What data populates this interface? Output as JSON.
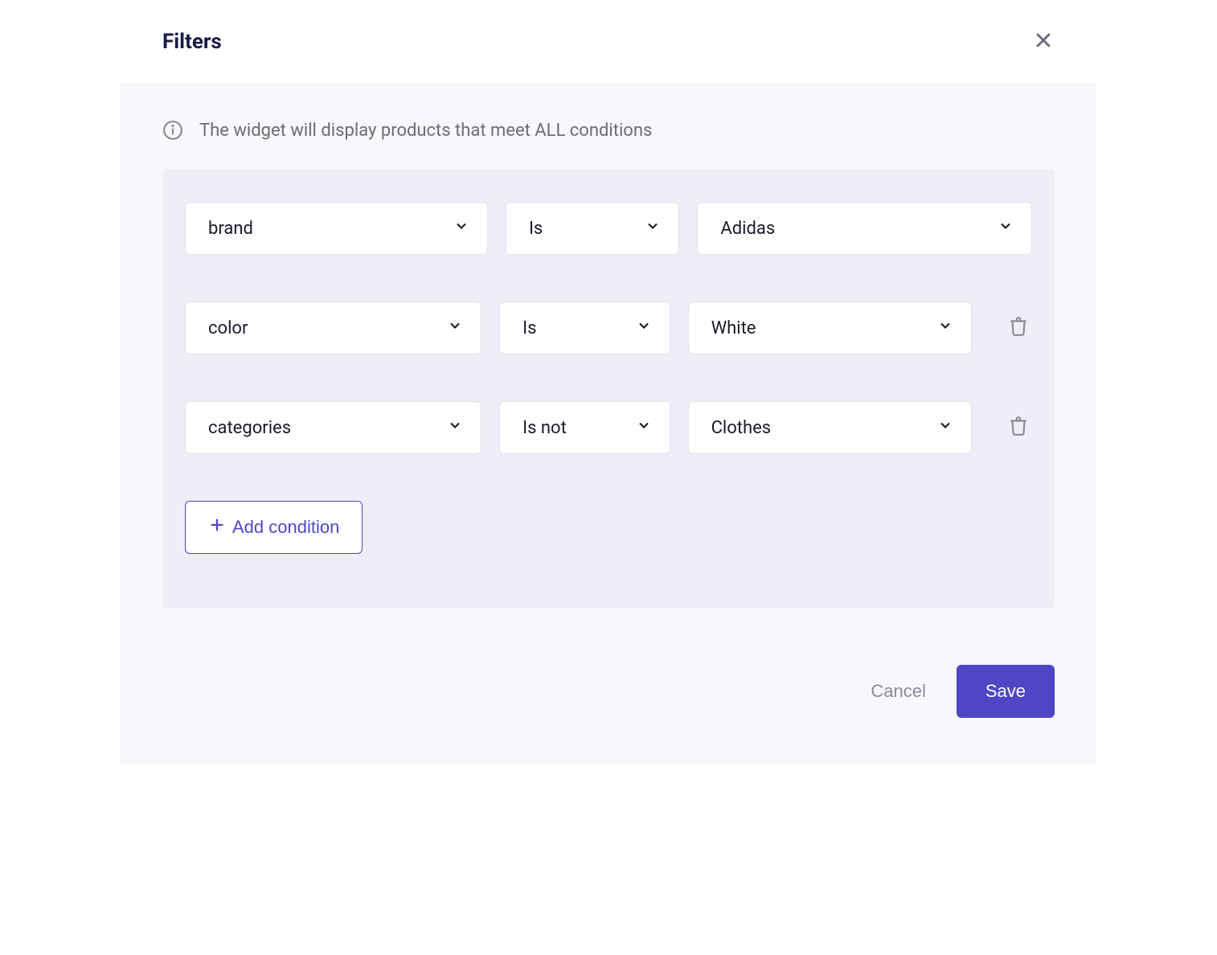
{
  "header": {
    "title": "Filters"
  },
  "info": {
    "text": "The widget will display products that meet ALL conditions"
  },
  "conditions": [
    {
      "field": "brand",
      "operator": "Is",
      "value": "Adidas",
      "deletable": false
    },
    {
      "field": "color",
      "operator": "Is",
      "value": "White",
      "deletable": true
    },
    {
      "field": "categories",
      "operator": "Is not",
      "value": "Clothes",
      "deletable": true
    }
  ],
  "buttons": {
    "add_condition": "Add condition",
    "cancel": "Cancel",
    "save": "Save"
  },
  "colors": {
    "accent": "#4e46c5",
    "panel_bg": "#efeef7",
    "body_bg": "#f8f8fc"
  }
}
